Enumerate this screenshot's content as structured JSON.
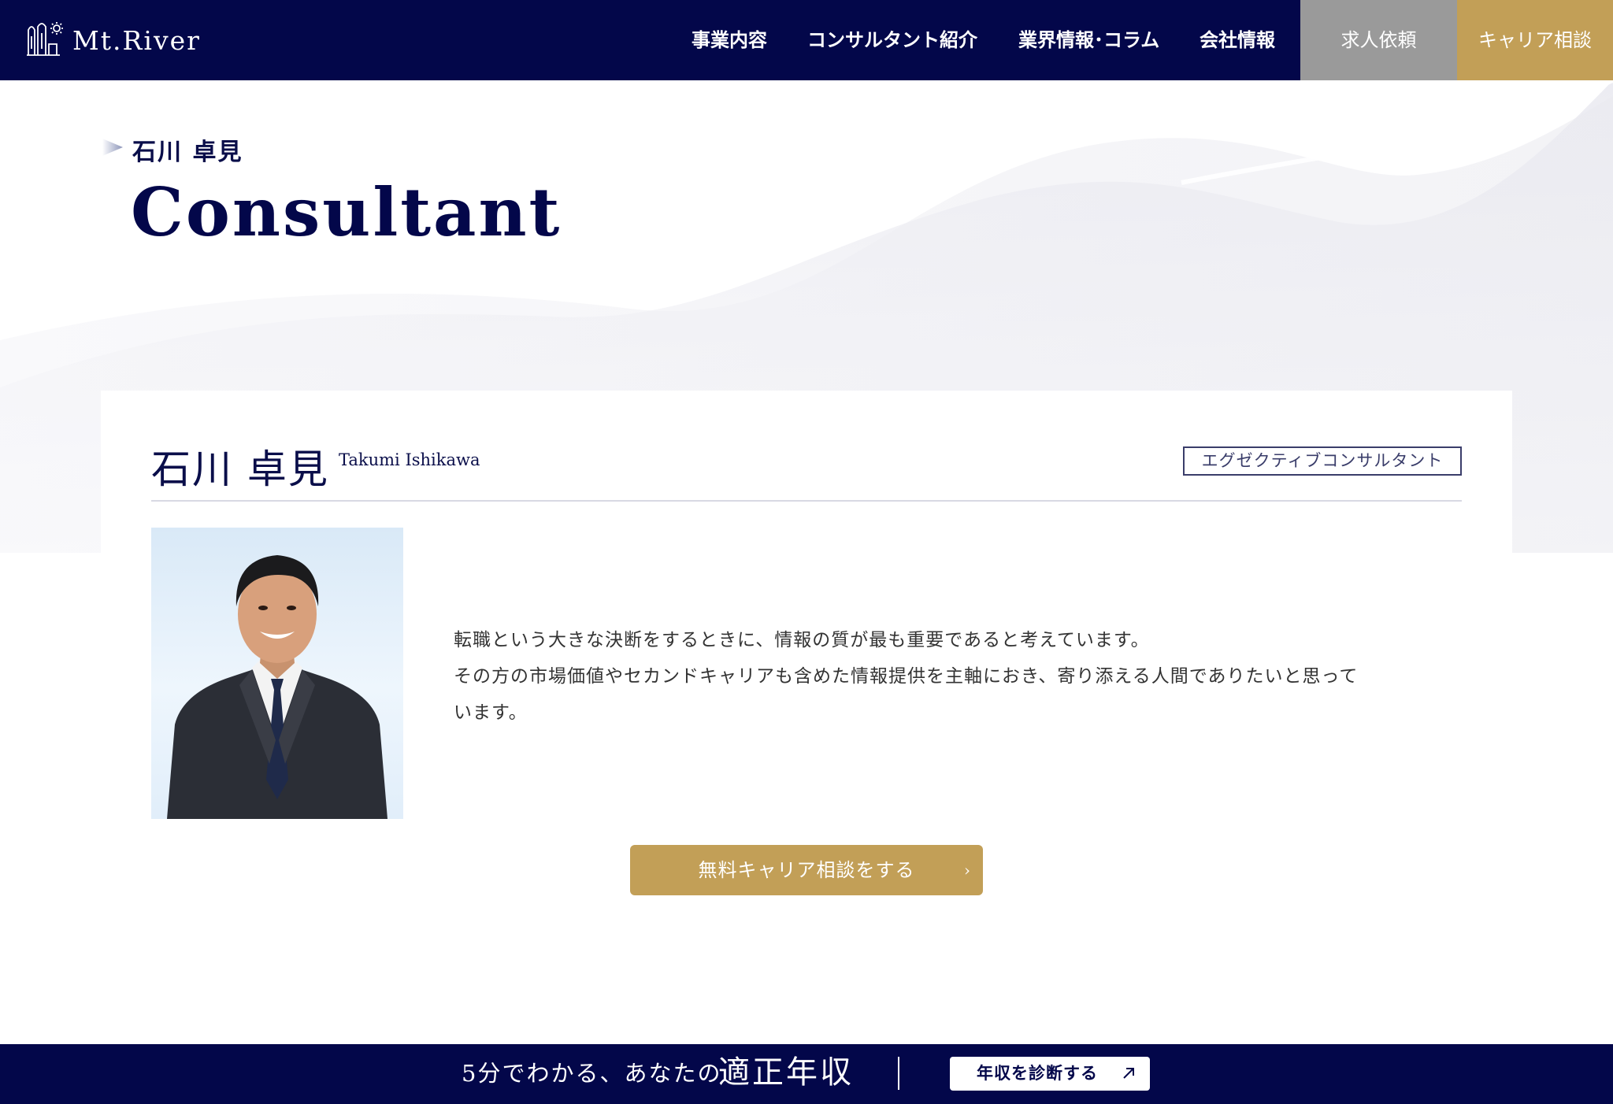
{
  "header": {
    "logo_text": "Mt.River",
    "nav": [
      {
        "label": "事業内容"
      },
      {
        "label": "コンサルタント紹介"
      },
      {
        "label": "業界情報･コラム"
      },
      {
        "label": "会社情報"
      }
    ],
    "job_request_label": "求人依頼",
    "career_consult_label": "キャリア相談"
  },
  "hero": {
    "subtitle": "石川 卓見",
    "title": "Consultant"
  },
  "profile": {
    "name_jp": "石川 卓見",
    "name_en": "Takumi Ishikawa",
    "role": "エグゼクティブコンサルタント",
    "bio": [
      "転職という大きな決断をするときに、情報の質が最も重要であると考えています。",
      "その方の市場価値やセカンドキャリアも含めた情報提供を主軸におき、寄り添える人間でありたいと思って",
      "います。"
    ],
    "cta_label": "無料キャリア相談をする",
    "cta_arrow": "›"
  },
  "footer_banner": {
    "lead": "5分でわかる、あなたの",
    "strong": "適正年収",
    "button_label": "年収を診断する"
  },
  "colors": {
    "navy": "#03074a",
    "gold": "#c29f57",
    "gray": "#9a9a9a"
  },
  "icons": {
    "logo": "mountain-river-logo-icon",
    "breadcrumb": "triangle-arrow-icon",
    "cta": "chevron-right-icon",
    "footer_button": "arrow-up-right-icon"
  }
}
